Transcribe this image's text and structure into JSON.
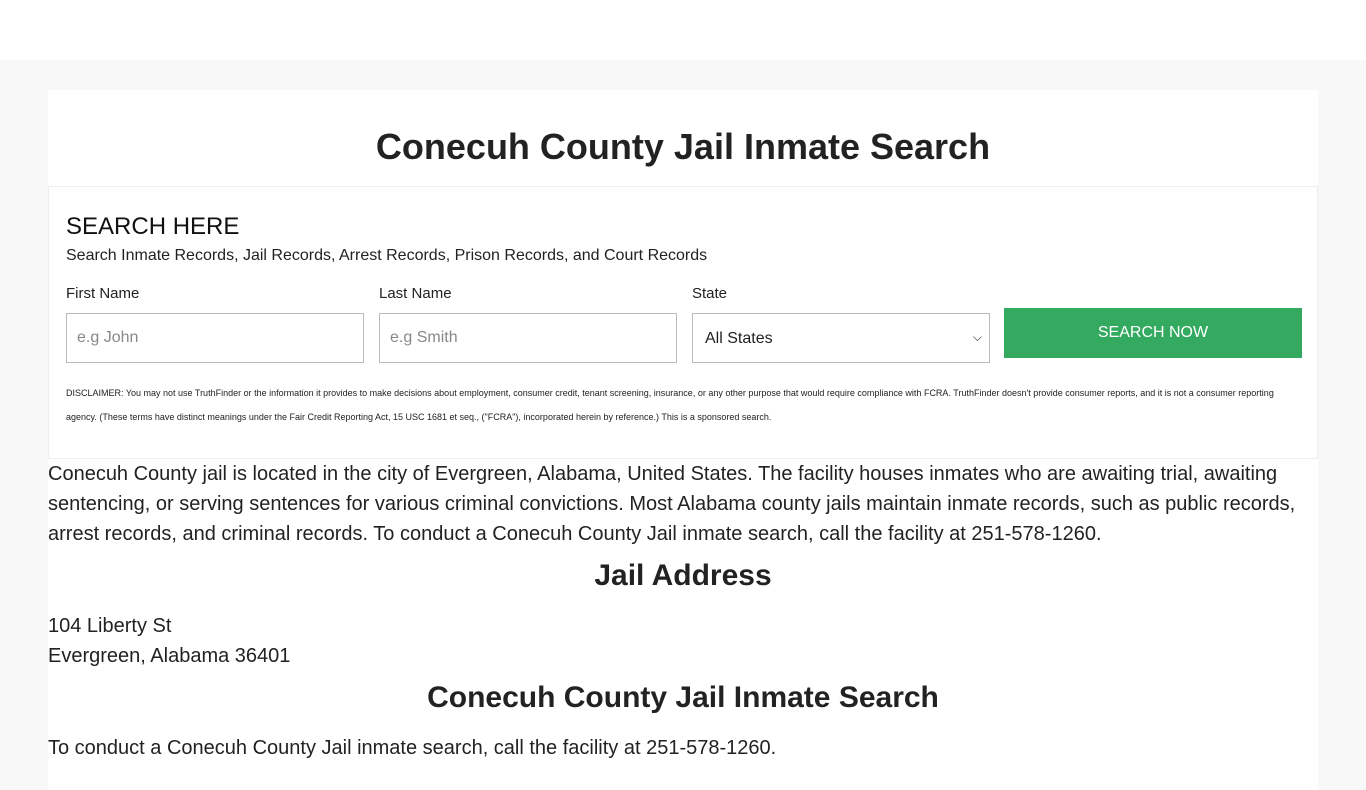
{
  "page": {
    "title": "Conecuh County Jail Inmate Search"
  },
  "search": {
    "heading": "SEARCH HERE",
    "subheading": "Search Inmate Records, Jail Records, Arrest Records, Prison Records, and Court Records",
    "first_name": {
      "label": "First Name",
      "placeholder": "e.g John",
      "value": ""
    },
    "last_name": {
      "label": "Last Name",
      "placeholder": "e.g Smith",
      "value": ""
    },
    "state": {
      "label": "State",
      "selected": "All States"
    },
    "button_label": "Search Now",
    "disclaimer": "DISCLAIMER: You may not use TruthFinder or the information it provides to make decisions about employment, consumer credit, tenant screening, insurance, or any other purpose that would require compliance with FCRA. TruthFinder doesn't provide consumer reports, and it is not a consumer reporting agency. (These terms have distinct meanings under the Fair Credit Reporting Act, 15 USC 1681 et seq., (\"FCRA\"), incorporated herein by reference.) This is a sponsored search."
  },
  "content": {
    "intro": "Conecuh County jail is located in the city of Evergreen, Alabama, United States. The facility houses inmates who are awaiting trial, awaiting sentencing, or serving sentences for various criminal convictions. Most Alabama county jails maintain inmate records, such as public records, arrest records, and criminal records. To conduct a Conecuh County Jail inmate search, call the facility at 251-578-1260.",
    "address_heading": "Jail Address",
    "address_line1": "104 Liberty St",
    "address_line2": "Evergreen, Alabama 36401",
    "search_heading": "Conecuh County Jail Inmate Search",
    "search_text": "To conduct a Conecuh County Jail inmate search, call the facility at 251-578-1260."
  },
  "colors": {
    "button": "#33aa60",
    "page_bg": "#f8f8f8"
  }
}
